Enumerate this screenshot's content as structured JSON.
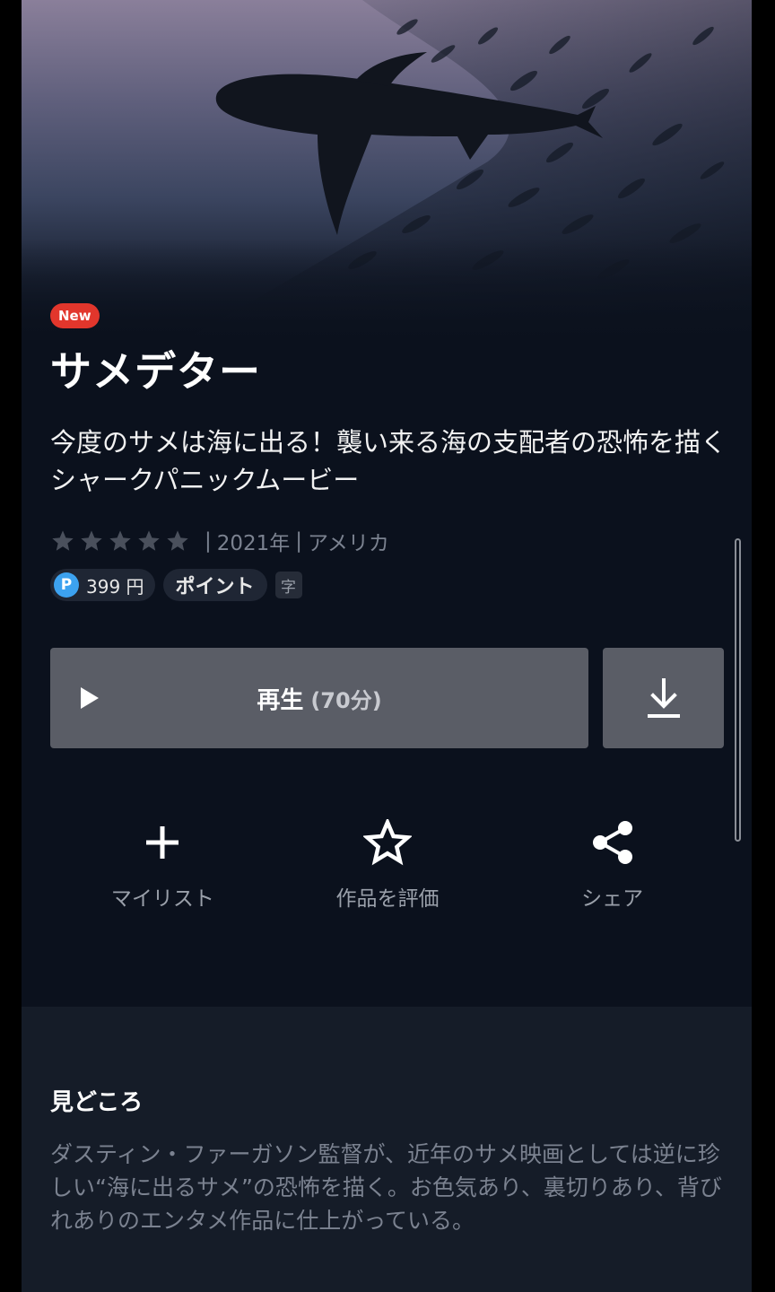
{
  "hero": {
    "image": "shark silhouette swimming under sea surface"
  },
  "badge": {
    "label": "New"
  },
  "title": "サメデター",
  "description": "今度のサメは海に出る！襲い来る海の支配者の恐怖を描くシャークパニックムービー",
  "meta": {
    "rating_stars": 5,
    "year": "2021年",
    "country": "アメリカ"
  },
  "chips": {
    "point_icon": "P",
    "price": "399 円",
    "point_label": "ポイント",
    "subtitle_badge": "字"
  },
  "play": {
    "label": "再生",
    "duration": "(70分)"
  },
  "actions": [
    {
      "label": "マイリスト",
      "icon": "plus-icon"
    },
    {
      "label": "作品を評価",
      "icon": "star-outline-icon"
    },
    {
      "label": "シェア",
      "icon": "share-icon"
    }
  ],
  "highlights": {
    "title": "見どころ",
    "text": "ダスティン・ファーガソン監督が、近年のサメ映画としては逆に珍しい“海に出るサメ”の恐怖を描く。お色気あり、裏切りあり、背びれありのエンタメ作品に仕上がっている。"
  },
  "colors": {
    "background": "#0b111d",
    "new_badge": "#e2362c",
    "button": "#5a5d66",
    "point_icon": "#3ca2f0"
  }
}
